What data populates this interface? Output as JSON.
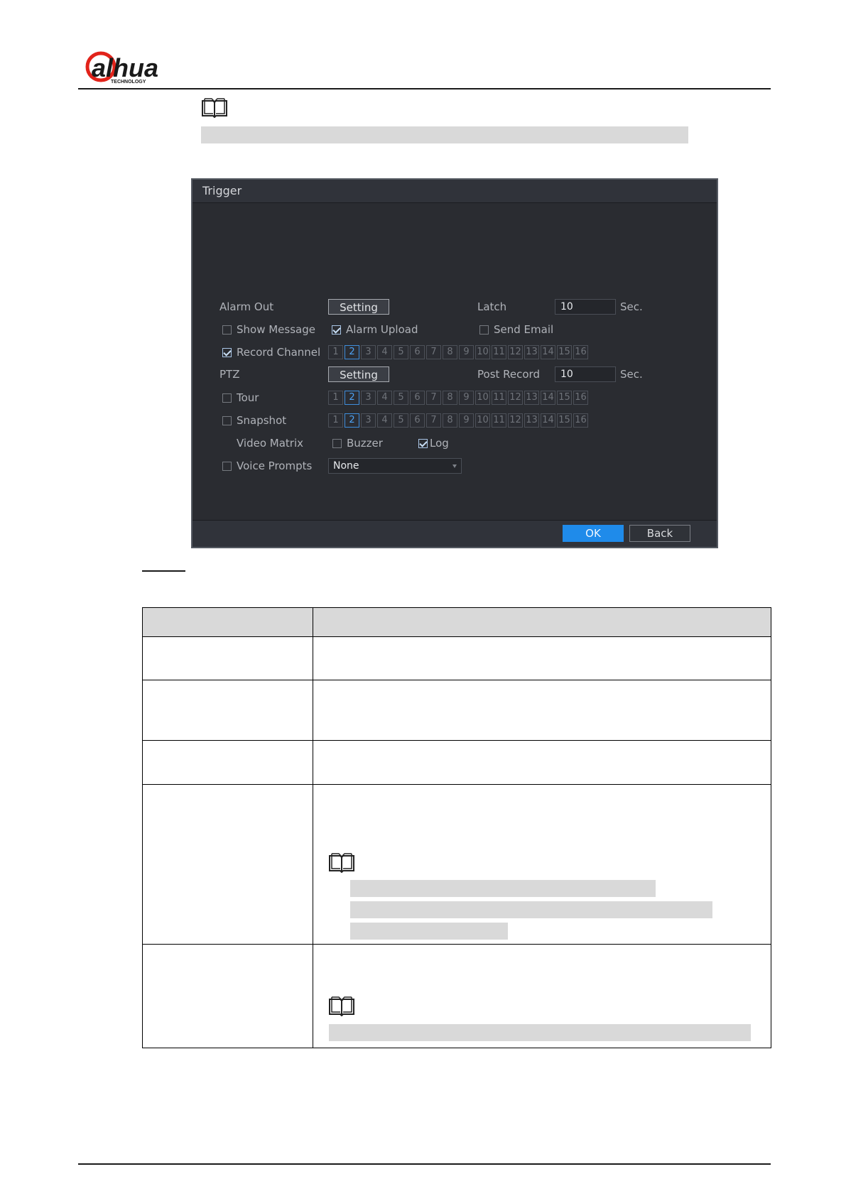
{
  "brand": {
    "logo_text": "alhua",
    "logo_subtext": "TECHNOLOGY",
    "accent_color": "#e2231a"
  },
  "dialog": {
    "title": "Trigger",
    "alarm_out": {
      "label": "Alarm Out",
      "button": "Setting"
    },
    "latch": {
      "label": "Latch",
      "value": "10",
      "unit": "Sec."
    },
    "show_message": {
      "label": "Show Message",
      "checked": false
    },
    "alarm_upload": {
      "label": "Alarm Upload",
      "checked": true
    },
    "send_email": {
      "label": "Send Email",
      "checked": false
    },
    "record_channel": {
      "label": "Record Channel",
      "checked": true
    },
    "ptz": {
      "label": "PTZ",
      "button": "Setting"
    },
    "post_record": {
      "label": "Post Record",
      "value": "10",
      "unit": "Sec."
    },
    "tour": {
      "label": "Tour",
      "checked": false
    },
    "snapshot": {
      "label": "Snapshot",
      "checked": false
    },
    "video_matrix": {
      "label": "Video Matrix"
    },
    "buzzer": {
      "label": "Buzzer",
      "checked": false
    },
    "log": {
      "label": "Log",
      "checked": true
    },
    "voice_prompts": {
      "label": "Voice Prompts",
      "checked": false,
      "selected": "None"
    },
    "channels": [
      "1",
      "2",
      "3",
      "4",
      "5",
      "6",
      "7",
      "8",
      "9",
      "10",
      "11",
      "12",
      "13",
      "14",
      "15",
      "16"
    ],
    "selected_channel": "2",
    "ok_label": "OK",
    "back_label": "Back",
    "ok_color": "#1f8bea"
  }
}
